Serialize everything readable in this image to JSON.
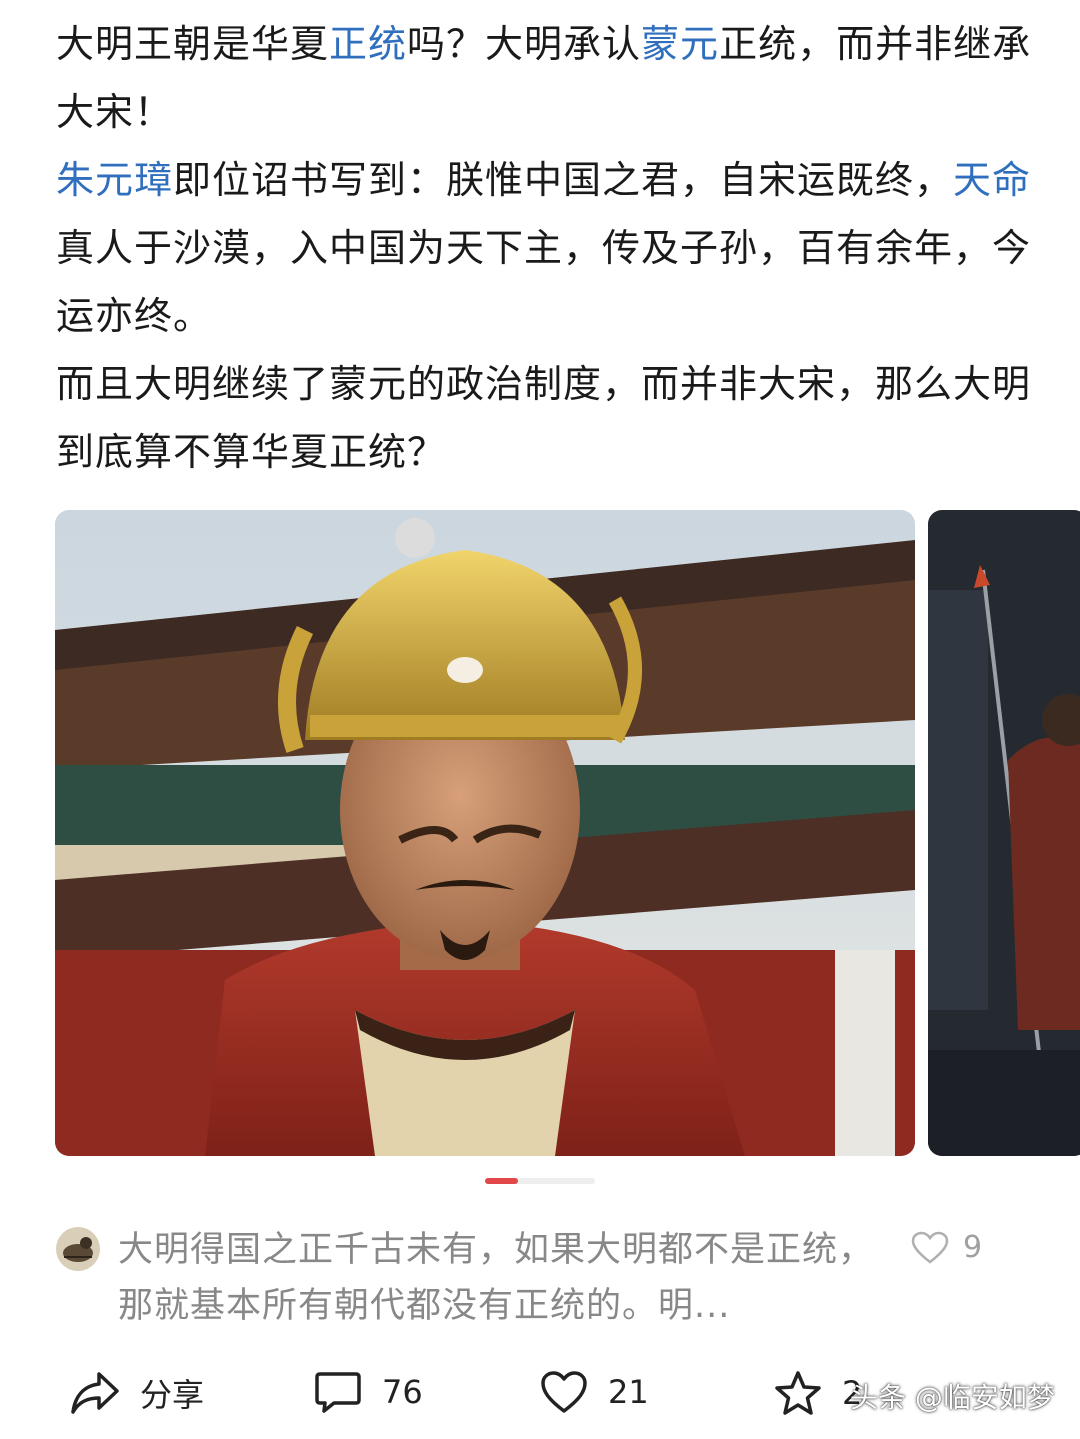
{
  "article": {
    "p1": {
      "t1": "大明王朝是华夏",
      "k1": "正统",
      "t2": "吗？大明承认",
      "k2": "蒙元",
      "t3": "正统，而并非继承大宋！"
    },
    "p2": {
      "k1": "朱元璋",
      "t1": "即位诏书写到：朕惟中国之君，自宋运既终，",
      "k2": "天命",
      "t2": "真人于沙漠，入中国为天下主，传及子孙，百有余年，今运亦终。"
    },
    "p3": "而且大明继续了蒙元的政治制度，而并非大宋，那么大明到底算不算华夏正统？"
  },
  "carousel": {
    "active_index": 0,
    "total_slides": 3
  },
  "comment": {
    "text": "大明得国之正千古未有，如果大明都不是正统，那就基本所有朝代都没有正统的。明...",
    "like_count": "9"
  },
  "actions": {
    "share_label": "分享",
    "comment_count": "76",
    "like_count": "21",
    "favorite_count": "2"
  },
  "watermark": "头条 @临安如梦",
  "colors": {
    "keyword": "#2f6fbd",
    "accent": "#e2474a",
    "muted": "#888888"
  }
}
